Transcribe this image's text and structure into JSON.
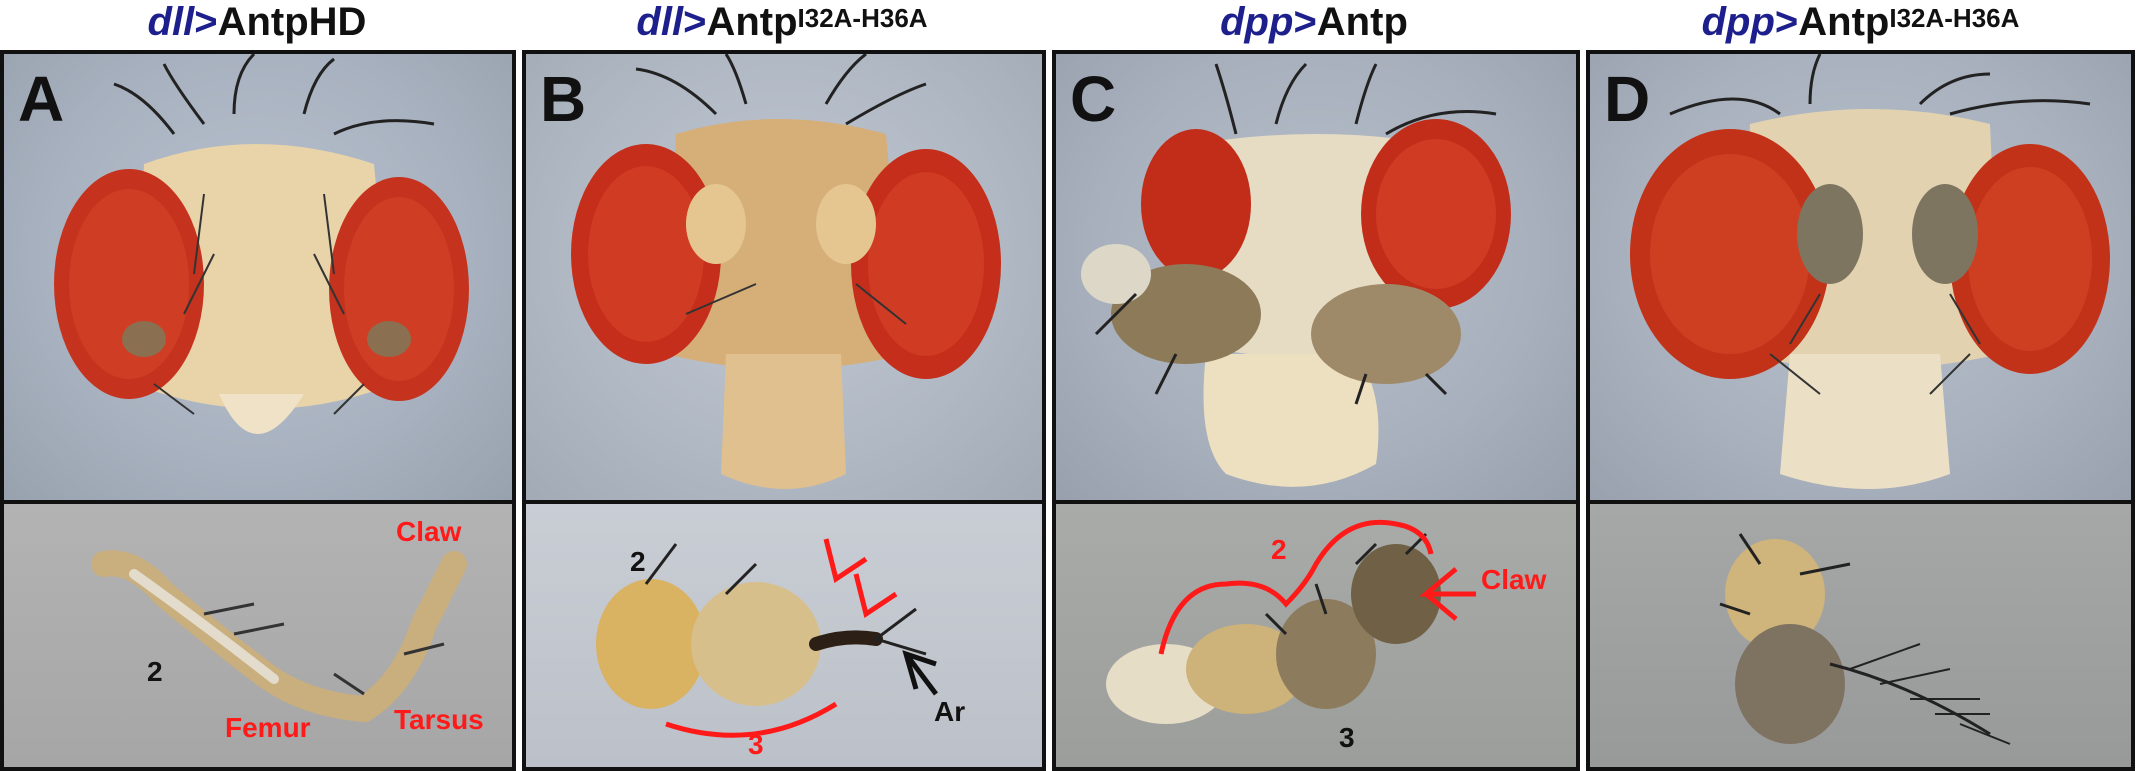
{
  "colors": {
    "gene_blue": "#1d1f8c",
    "annotation_red": "#ff1a1a",
    "border": "#111111"
  },
  "panels": [
    {
      "gene": "dll",
      "protein": "AntpHD",
      "sup": "",
      "letter": "A",
      "labels": [
        "Claw",
        "2",
        "Femur",
        "Tarsus"
      ]
    },
    {
      "gene": "dll",
      "protein": "Antp",
      "sup": "I32A-H36A",
      "letter": "B",
      "labels": [
        "2",
        "Ar",
        "3"
      ]
    },
    {
      "gene": "dpp",
      "protein": "Antp",
      "sup": "",
      "letter": "C",
      "labels": [
        "2",
        "Claw",
        "3"
      ]
    },
    {
      "gene": "dpp",
      "protein": "Antp",
      "sup": "I32A-H36A",
      "letter": "D",
      "labels": []
    }
  ]
}
